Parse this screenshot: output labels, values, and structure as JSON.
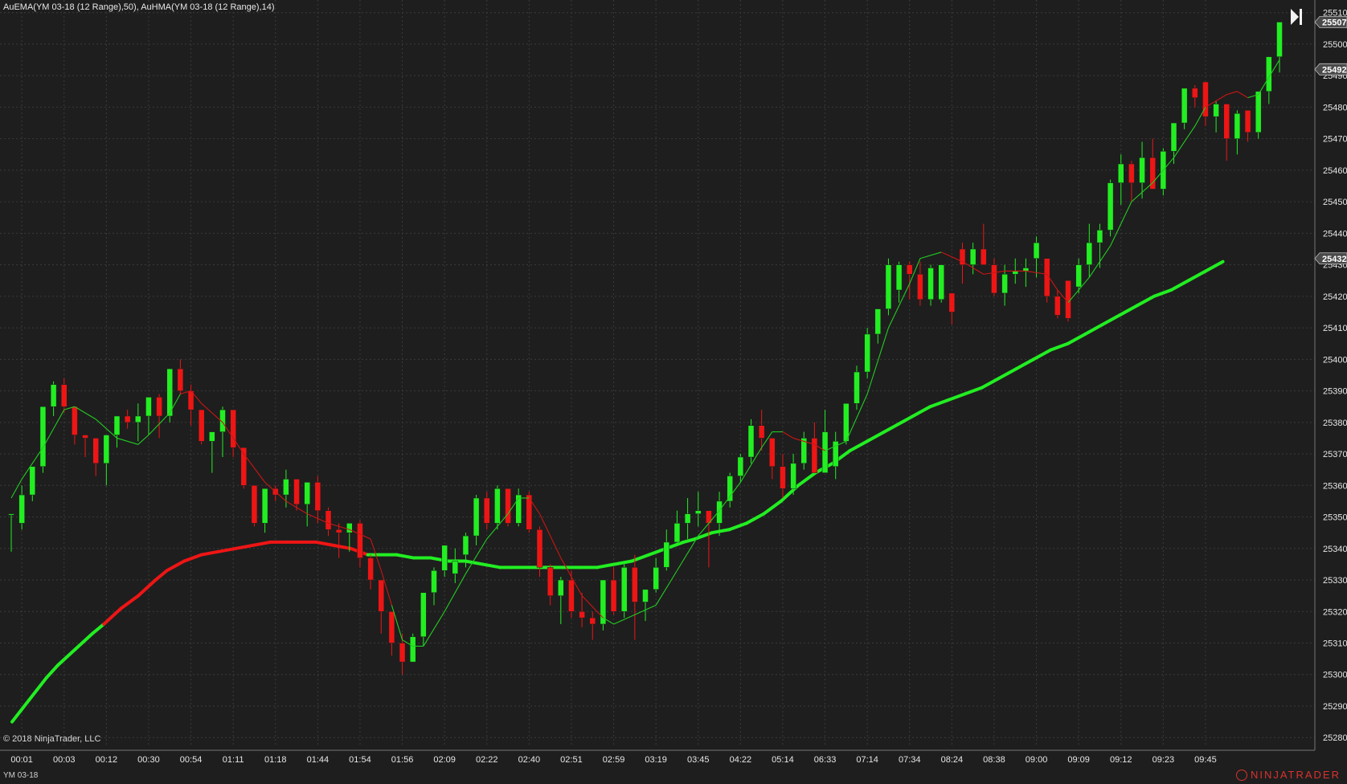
{
  "header": {
    "indicators_label": "AuEMA(YM 03-18 (12 Range),50), AuHMA(YM 03-18 (12 Range),14)"
  },
  "footer": {
    "copyright": "© 2018 NinjaTrader, LLC",
    "instrument": "YM 03-18",
    "brand": "NINJATRADER"
  },
  "icons": {
    "navigate_end": "skip-to-end-icon",
    "brand_logo": "ninjatrader-logo-icon"
  },
  "colors": {
    "background": "#1e1e1e",
    "grid": "#3a3a3a",
    "up": "#22ee22",
    "down": "#ee1515",
    "ema_up": "#22ee22",
    "ema_down": "#ee1515",
    "hma_up": "#22cc22",
    "hma_down": "#cc1515",
    "price_tag": "#4a4a4a"
  },
  "chart_data": {
    "type": "candlestick",
    "ylim": [
      25277,
      25514
    ],
    "y_ticks": [
      25280,
      25290,
      25300,
      25310,
      25320,
      25330,
      25340,
      25350,
      25360,
      25370,
      25380,
      25390,
      25400,
      25410,
      25420,
      25430,
      25440,
      25450,
      25460,
      25470,
      25480,
      25490,
      25500,
      25510
    ],
    "x_labels": [
      {
        "bar": 1,
        "label": "00:01"
      },
      {
        "bar": 5,
        "label": "00:03"
      },
      {
        "bar": 9,
        "label": "00:12"
      },
      {
        "bar": 13,
        "label": "00:30"
      },
      {
        "bar": 17,
        "label": "00:54"
      },
      {
        "bar": 21,
        "label": "01:11"
      },
      {
        "bar": 25,
        "label": "01:18"
      },
      {
        "bar": 29,
        "label": "01:44"
      },
      {
        "bar": 33,
        "label": "01:54"
      },
      {
        "bar": 37,
        "label": "01:56"
      },
      {
        "bar": 41,
        "label": "02:09"
      },
      {
        "bar": 45,
        "label": "02:22"
      },
      {
        "bar": 49,
        "label": "02:40"
      },
      {
        "bar": 53,
        "label": "02:51"
      },
      {
        "bar": 57,
        "label": "02:59"
      },
      {
        "bar": 61,
        "label": "03:19"
      },
      {
        "bar": 65,
        "label": "03:45"
      },
      {
        "bar": 69,
        "label": "04:22"
      },
      {
        "bar": 73,
        "label": "05:14"
      },
      {
        "bar": 77,
        "label": "06:33"
      },
      {
        "bar": 81,
        "label": "07:14"
      },
      {
        "bar": 85,
        "label": "07:34"
      },
      {
        "bar": 89,
        "label": "08:24"
      },
      {
        "bar": 93,
        "label": "08:38"
      },
      {
        "bar": 97,
        "label": "09:00"
      },
      {
        "bar": 101,
        "label": "09:09"
      },
      {
        "bar": 105,
        "label": "09:12"
      },
      {
        "bar": 109,
        "label": "09:23"
      },
      {
        "bar": 113,
        "label": "09:45"
      }
    ],
    "candles": [
      [
        25351,
        25351,
        25339,
        25351
      ],
      [
        25348,
        25360,
        25346,
        25357
      ],
      [
        25357,
        25366,
        25355,
        25366
      ],
      [
        25366,
        25385,
        25364,
        25385
      ],
      [
        25385,
        25393,
        25382,
        25392
      ],
      [
        25392,
        25394,
        25383,
        25385
      ],
      [
        25385,
        25385,
        25373,
        25376
      ],
      [
        25376,
        25376,
        25369,
        25375
      ],
      [
        25375,
        25375,
        25363,
        25367
      ],
      [
        25367,
        25376,
        25360,
        25376
      ],
      [
        25376,
        25382,
        25372,
        25382
      ],
      [
        25382,
        25384,
        25378,
        25380
      ],
      [
        25380,
        25386,
        25374,
        25382
      ],
      [
        25382,
        25386,
        25376,
        25388
      ],
      [
        25388,
        25389,
        25375,
        25382
      ],
      [
        25382,
        25393,
        25380,
        25397
      ],
      [
        25397,
        25400,
        25389,
        25390
      ],
      [
        25390,
        25392,
        25379,
        25384
      ],
      [
        25384,
        25384,
        25373,
        25374
      ],
      [
        25374,
        25374,
        25364,
        25377
      ],
      [
        25377,
        25385,
        25369,
        25384
      ],
      [
        25384,
        25384,
        25369,
        25372
      ],
      [
        25372,
        25372,
        25359,
        25360
      ],
      [
        25360,
        25360,
        25347,
        25348
      ],
      [
        25348,
        25352,
        25345,
        25359
      ],
      [
        25359,
        25360,
        25355,
        25357
      ],
      [
        25357,
        25365,
        25353,
        25362
      ],
      [
        25362,
        25362,
        25352,
        25354
      ],
      [
        25354,
        25356,
        25347,
        25361
      ],
      [
        25361,
        25363,
        25348,
        25352
      ],
      [
        25352,
        25353,
        25344,
        25346
      ],
      [
        25346,
        25348,
        25337,
        25345
      ],
      [
        25345,
        25346,
        25339,
        25348
      ],
      [
        25348,
        25349,
        25334,
        25337
      ],
      [
        25337,
        25338,
        25327,
        25330
      ],
      [
        25330,
        25330,
        25313,
        25320
      ],
      [
        25320,
        25320,
        25306,
        25310
      ],
      [
        25310,
        25313,
        25300,
        25304
      ],
      [
        25304,
        25313,
        25304,
        25312
      ],
      [
        25312,
        25319,
        25309,
        25326
      ],
      [
        25326,
        25334,
        25322,
        25333
      ],
      [
        25333,
        25341,
        25331,
        25341
      ],
      [
        25332,
        25340,
        25329,
        25336
      ],
      [
        25338,
        25345,
        25334,
        25344
      ],
      [
        25344,
        25357,
        25341,
        25356
      ],
      [
        25356,
        25358,
        25346,
        25348
      ],
      [
        25348,
        25360,
        25346,
        25359
      ],
      [
        25359,
        25359,
        25347,
        25348
      ],
      [
        25348,
        25359,
        25347,
        25357
      ],
      [
        25357,
        25358,
        25345,
        25346
      ],
      [
        25346,
        25347,
        25331,
        25334
      ],
      [
        25334,
        25335,
        25322,
        25325
      ],
      [
        25325,
        25331,
        25316,
        25330
      ],
      [
        25330,
        25333,
        25318,
        25320
      ],
      [
        25320,
        25326,
        25315,
        25318
      ],
      [
        25318,
        25320,
        25311,
        25316
      ],
      [
        25316,
        25323,
        25314,
        25330
      ],
      [
        25330,
        25334,
        25319,
        25320
      ],
      [
        25320,
        25335,
        25318,
        25334
      ],
      [
        25334,
        25338,
        25311,
        25323
      ],
      [
        25323,
        25326,
        25317,
        25327
      ],
      [
        25327,
        25337,
        25326,
        25334
      ],
      [
        25334,
        25346,
        25333,
        25342
      ],
      [
        25342,
        25352,
        25341,
        25348
      ],
      [
        25348,
        25356,
        25343,
        25351
      ],
      [
        25351,
        25358,
        25347,
        25352
      ],
      [
        25352,
        25352,
        25334,
        25348
      ],
      [
        25348,
        25358,
        25344,
        25355
      ],
      [
        25355,
        25364,
        25353,
        25363
      ],
      [
        25363,
        25370,
        25361,
        25369
      ],
      [
        25369,
        25381,
        25367,
        25379
      ],
      [
        25379,
        25384,
        25371,
        25375
      ],
      [
        25375,
        25375,
        25362,
        25366
      ],
      [
        25366,
        25370,
        25356,
        25359
      ],
      [
        25359,
        25370,
        25357,
        25367
      ],
      [
        25367,
        25377,
        25365,
        25375
      ],
      [
        25375,
        25380,
        25365,
        25364
      ],
      [
        25364,
        25384,
        25366,
        25377
      ],
      [
        25366,
        25377,
        25362,
        25374
      ],
      [
        25374,
        25386,
        25373,
        25386
      ],
      [
        25386,
        25398,
        25384,
        25396
      ],
      [
        25396,
        25410,
        25394,
        25408
      ],
      [
        25408,
        25415,
        25405,
        25416
      ],
      [
        25416,
        25432,
        25414,
        25430
      ],
      [
        25422,
        25431,
        25418,
        25430
      ],
      [
        25430,
        25431,
        25419,
        25427
      ],
      [
        25427,
        25431,
        25417,
        25419
      ],
      [
        25419,
        25430,
        25417,
        25429
      ],
      [
        25419,
        25430,
        25418,
        25430
      ],
      [
        25421,
        25421,
        25411,
        25415
      ],
      [
        25435,
        25437,
        25424,
        25430
      ],
      [
        25430,
        25437,
        25427,
        25435
      ],
      [
        25435,
        25443,
        25430,
        25430
      ],
      [
        25430,
        25432,
        25420,
        25421
      ],
      [
        25421,
        25430,
        25417,
        25427
      ],
      [
        25427,
        25432,
        25424,
        25428
      ],
      [
        25428,
        25432,
        25423,
        25429
      ],
      [
        25432,
        25439,
        25426,
        25437
      ],
      [
        25432,
        25432,
        25418,
        25420
      ],
      [
        25420,
        25422,
        25413,
        25414
      ],
      [
        25425,
        25425,
        25412,
        25413
      ],
      [
        25423,
        25432,
        25421,
        25430
      ],
      [
        25430,
        25443,
        25426,
        25437
      ],
      [
        25437,
        25443,
        25429,
        25441
      ],
      [
        25441,
        25457,
        25439,
        25456
      ],
      [
        25456,
        25465,
        25449,
        25462
      ],
      [
        25462,
        25463,
        25450,
        25456
      ],
      [
        25456,
        25469,
        25451,
        25464
      ],
      [
        25464,
        25470,
        25454,
        25454
      ],
      [
        25454,
        25467,
        25452,
        25466
      ],
      [
        25466,
        25475,
        25462,
        25475
      ],
      [
        25475,
        25486,
        25473,
        25486
      ],
      [
        25486,
        25487,
        25480,
        25483
      ],
      [
        25488,
        25488,
        25474,
        25477
      ],
      [
        25477,
        25482,
        25472,
        25481
      ],
      [
        25481,
        25481,
        25463,
        25470
      ],
      [
        25470,
        25479,
        25465,
        25478
      ],
      [
        25479,
        25479,
        25469,
        25472
      ],
      [
        25472,
        25484,
        25470,
        25485
      ],
      [
        25485,
        25496,
        25481,
        25496
      ],
      [
        25496,
        25507,
        25491,
        25507
      ]
    ],
    "ema50": [
      [
        0,
        25285
      ],
      [
        3,
        25292
      ],
      [
        6,
        25299
      ],
      [
        8,
        25303
      ],
      [
        11,
        25308
      ],
      [
        14,
        25313
      ],
      [
        16,
        25316
      ],
      [
        19,
        25321
      ],
      [
        22,
        25325
      ],
      [
        25,
        25330
      ],
      [
        27,
        25333
      ],
      [
        30,
        25336
      ],
      [
        33,
        25338
      ],
      [
        36,
        25339
      ],
      [
        39,
        25340
      ],
      [
        42,
        25341
      ],
      [
        45,
        25342
      ],
      [
        48,
        25342
      ],
      [
        50,
        25342
      ],
      [
        53,
        25342
      ],
      [
        56,
        25341
      ],
      [
        59,
        25340
      ],
      [
        62,
        25338
      ],
      [
        64,
        25338
      ],
      [
        67,
        25338
      ],
      [
        70,
        25337
      ],
      [
        73,
        25337
      ],
      [
        76,
        25336
      ],
      [
        79,
        25336
      ],
      [
        82,
        25335
      ],
      [
        85,
        25334
      ],
      [
        87,
        25334
      ],
      [
        90,
        25334
      ],
      [
        93,
        25334
      ],
      [
        96,
        25334
      ],
      [
        99,
        25334
      ],
      [
        102,
        25334
      ],
      [
        105,
        25335
      ],
      [
        108,
        25336
      ],
      [
        111,
        25338
      ],
      [
        114,
        25340
      ],
      [
        117,
        25342
      ],
      [
        119,
        25343
      ],
      [
        122,
        25345
      ],
      [
        125,
        25346
      ],
      [
        128,
        25348
      ],
      [
        131,
        25351
      ],
      [
        134,
        25355
      ],
      [
        137,
        25360
      ],
      [
        140,
        25364
      ],
      [
        143,
        25367
      ],
      [
        146,
        25371
      ],
      [
        149,
        25374
      ],
      [
        152,
        25377
      ],
      [
        155,
        25380
      ],
      [
        157,
        25382
      ],
      [
        160,
        25385
      ],
      [
        163,
        25387
      ],
      [
        166,
        25389
      ],
      [
        169,
        25391
      ],
      [
        172,
        25394
      ],
      [
        175,
        25397
      ],
      [
        178,
        25400
      ],
      [
        181,
        25403
      ],
      [
        184,
        25405
      ],
      [
        187,
        25408
      ],
      [
        190,
        25411
      ],
      [
        193,
        25414
      ],
      [
        196,
        25417
      ],
      [
        199,
        25420
      ],
      [
        202,
        25422
      ],
      [
        205,
        25425
      ],
      [
        208,
        25428
      ],
      [
        211,
        25431
      ]
    ],
    "ema50_red_range": [
      17.2,
      61.6
    ],
    "hma14": [
      [
        0,
        25356
      ],
      [
        1,
        25362
      ],
      [
        3,
        25372
      ],
      [
        5,
        25384
      ],
      [
        6,
        25385
      ],
      [
        8,
        25381
      ],
      [
        10,
        25375
      ],
      [
        12,
        25373
      ],
      [
        13,
        25376
      ],
      [
        15,
        25383
      ],
      [
        16,
        25389
      ],
      [
        17,
        25390
      ],
      [
        18,
        25386
      ],
      [
        20,
        25380
      ],
      [
        22,
        25370
      ],
      [
        24,
        25361
      ],
      [
        26,
        25355
      ],
      [
        28,
        25351
      ],
      [
        30,
        25348
      ],
      [
        32,
        25346
      ],
      [
        34,
        25343
      ],
      [
        35,
        25333
      ],
      [
        36,
        25322
      ],
      [
        37,
        25311
      ],
      [
        38,
        25309
      ],
      [
        39,
        25309
      ],
      [
        41,
        25320
      ],
      [
        43,
        25332
      ],
      [
        45,
        25343
      ],
      [
        47,
        25351
      ],
      [
        48,
        25356
      ],
      [
        49,
        25356
      ],
      [
        50,
        25351
      ],
      [
        52,
        25337
      ],
      [
        54,
        25325
      ],
      [
        56,
        25318
      ],
      [
        57,
        25316
      ],
      [
        59,
        25319
      ],
      [
        61,
        25322
      ],
      [
        63,
        25333
      ],
      [
        65,
        25344
      ],
      [
        67,
        25352
      ],
      [
        69,
        25361
      ],
      [
        71,
        25372
      ],
      [
        72,
        25377
      ],
      [
        73,
        25377
      ],
      [
        74,
        25375
      ],
      [
        76,
        25373
      ],
      [
        77,
        25371
      ],
      [
        79,
        25374
      ],
      [
        81,
        25389
      ],
      [
        83,
        25410
      ],
      [
        85,
        25424
      ],
      [
        86,
        25432
      ],
      [
        88,
        25434
      ],
      [
        90,
        25431
      ],
      [
        92,
        25427
      ],
      [
        94,
        25428
      ],
      [
        96,
        25428
      ],
      [
        98,
        25427
      ],
      [
        99,
        25422
      ],
      [
        100,
        25418
      ],
      [
        102,
        25426
      ],
      [
        104,
        25436
      ],
      [
        106,
        25450
      ],
      [
        108,
        25456
      ],
      [
        110,
        25464
      ],
      [
        112,
        25474
      ],
      [
        113,
        25480
      ],
      [
        115,
        25484
      ],
      [
        116,
        25485
      ],
      [
        117,
        25483
      ],
      [
        118,
        25484
      ],
      [
        120,
        25495
      ]
    ],
    "hma14_red_ranges": [
      [
        16,
        36
      ],
      [
        49,
        56
      ],
      [
        73,
        77
      ],
      [
        88,
        100
      ],
      [
        113,
        117
      ]
    ],
    "price_tags": [
      25507,
      25492,
      25432
    ]
  }
}
